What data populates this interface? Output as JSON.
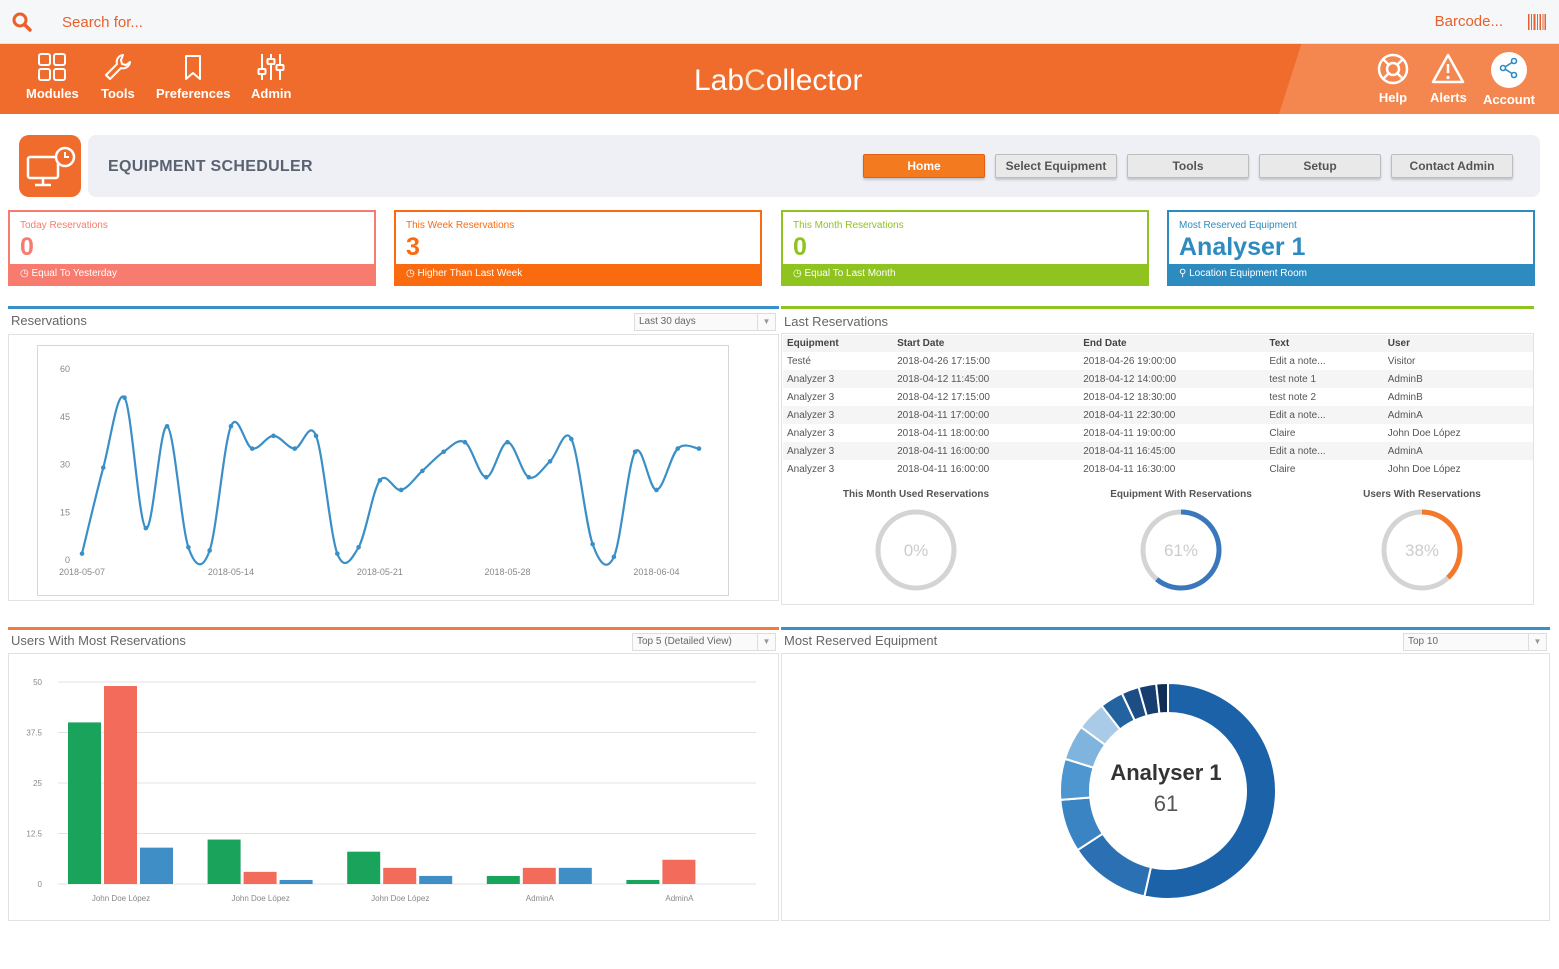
{
  "search": {
    "placeholder": "Search for...",
    "barcode_label": "Barcode..."
  },
  "nav": {
    "left": [
      {
        "label": "Modules",
        "icon": "grid-icon"
      },
      {
        "label": "Tools",
        "icon": "wrench-icon"
      },
      {
        "label": "Preferences",
        "icon": "bookmark-icon"
      },
      {
        "label": "Admin",
        "icon": "sliders-icon"
      }
    ],
    "logo": {
      "part1": "Lab",
      "part2": "C",
      "part3": "ollector"
    },
    "right": [
      {
        "label": "Help",
        "icon": "lifebuoy-icon"
      },
      {
        "label": "Alerts",
        "icon": "warning-icon"
      },
      {
        "label": "Account",
        "icon": "share-icon"
      }
    ]
  },
  "scheduler": {
    "title": "EQUIPMENT SCHEDULER",
    "buttons": [
      "Home",
      "Select Equipment",
      "Tools",
      "Setup",
      "Contact Admin"
    ]
  },
  "cards": [
    {
      "label": "Today Reservations",
      "value": "0",
      "footer": "Equal To Yesterday",
      "color": "#f77b6e",
      "footer_icon": "clock-icon"
    },
    {
      "label": "This Week Reservations",
      "value": "3",
      "footer": "Higher Than Last Week",
      "color": "#f96b0e",
      "footer_icon": "clock-icon"
    },
    {
      "label": "This Month Reservations",
      "value": "0",
      "footer": "Equal To Last Month",
      "color": "#8fc31f",
      "footer_icon": "clock-icon"
    },
    {
      "label": "Most Reserved Equipment",
      "value": "Analyser 1",
      "footer": "Location Equipment Room",
      "color": "#2d8bc0",
      "footer_icon": "map-pin-icon"
    }
  ],
  "reservations_panel": {
    "title": "Reservations",
    "range_select": "Last 30 days"
  },
  "last_reservations": {
    "title": "Last Reservations",
    "columns": [
      "Equipment",
      "Start Date",
      "End Date",
      "Text",
      "User"
    ],
    "rows": [
      [
        "Testé",
        "2018-04-26 17:15:00",
        "2018-04-26 19:00:00",
        "Edit a note...",
        "Visitor"
      ],
      [
        "Analyzer 3",
        "2018-04-12 11:45:00",
        "2018-04-12 14:00:00",
        "test note 1",
        "AdminB"
      ],
      [
        "Analyzer 3",
        "2018-04-12 17:15:00",
        "2018-04-12 18:30:00",
        "test note 2",
        "AdminB"
      ],
      [
        "Analyzer 3",
        "2018-04-11 17:00:00",
        "2018-04-11 22:30:00",
        "Edit a note...",
        "AdminA"
      ],
      [
        "Analyzer 3",
        "2018-04-11 18:00:00",
        "2018-04-11 19:00:00",
        "Claire",
        "John Doe López"
      ],
      [
        "Analyzer 3",
        "2018-04-11 16:00:00",
        "2018-04-11 16:45:00",
        "Edit a note...",
        "AdminA"
      ],
      [
        "Analyzer 3",
        "2018-04-11 16:00:00",
        "2018-04-11 16:30:00",
        "Claire",
        "John Doe López"
      ]
    ],
    "gauges": [
      {
        "title": "This Month Used Reservations",
        "value": 0,
        "label": "0%",
        "color": "#cccccc"
      },
      {
        "title": "Equipment With Reservations",
        "value": 61,
        "label": "61%",
        "color": "#3a78bd"
      },
      {
        "title": "Users With Reservations",
        "value": 38,
        "label": "38%",
        "color": "#f4782c"
      }
    ]
  },
  "users_panel": {
    "title": "Users With Most Reservations",
    "select": "Top 5 (Detailed View)"
  },
  "most_reserved_panel": {
    "title": "Most Reserved Equipment",
    "select": "Top 10"
  },
  "chart_data": [
    {
      "type": "line",
      "x": [
        "2018-05-07",
        "2018-05-08",
        "2018-05-09",
        "2018-05-10",
        "2018-05-11",
        "2018-05-12",
        "2018-05-13",
        "2018-05-14",
        "2018-05-15",
        "2018-05-16",
        "2018-05-17",
        "2018-05-18",
        "2018-05-19",
        "2018-05-20",
        "2018-05-21",
        "2018-05-22",
        "2018-05-23",
        "2018-05-24",
        "2018-05-25",
        "2018-05-26",
        "2018-05-28",
        "2018-05-29",
        "2018-05-30",
        "2018-05-31",
        "2018-06-01",
        "2018-06-02",
        "2018-06-03",
        "2018-06-04",
        "2018-06-05",
        "2018-06-06"
      ],
      "values": [
        2,
        29,
        51,
        10,
        42,
        4,
        3,
        42,
        35,
        39,
        35,
        39,
        2,
        4,
        25,
        22,
        28,
        34,
        37,
        26,
        37,
        26,
        31,
        38,
        5,
        1,
        34,
        22,
        35,
        35
      ],
      "xticks": [
        "2018-05-07",
        "2018-05-14",
        "2018-05-21",
        "2018-05-28",
        "2018-06-04"
      ],
      "yticks": [
        0,
        15,
        30,
        45,
        60
      ],
      "ylim": [
        0,
        60
      ],
      "color": "#3a8fc7"
    },
    {
      "type": "bar",
      "categories": [
        "John Doe López",
        "John Doe López",
        "John Doe López",
        "AdminA",
        "AdminA"
      ],
      "series": [
        {
          "values": [
            40,
            11,
            8,
            2,
            1
          ],
          "color": "#1aa35b"
        },
        {
          "values": [
            49,
            3,
            4,
            4,
            6
          ],
          "color": "#f26b5b"
        },
        {
          "values": [
            9,
            1,
            2,
            4,
            0
          ],
          "color": "#3f8ec5"
        }
      ],
      "yticks": [
        0,
        12.5,
        25,
        37.5,
        50
      ],
      "ylim": [
        0,
        50
      ]
    },
    {
      "type": "pie",
      "center_label": "Analyser 1",
      "center_value": "61",
      "values": [
        61,
        14,
        9,
        7,
        6,
        5,
        4,
        3,
        3,
        2
      ],
      "colors": [
        "#1c62a8",
        "#2a70b2",
        "#3a84c3",
        "#4d96cf",
        "#7eb4dd",
        "#a9cbe8",
        "#2363a0",
        "#1d4d85",
        "#163e70",
        "#0f2d55"
      ]
    }
  ]
}
